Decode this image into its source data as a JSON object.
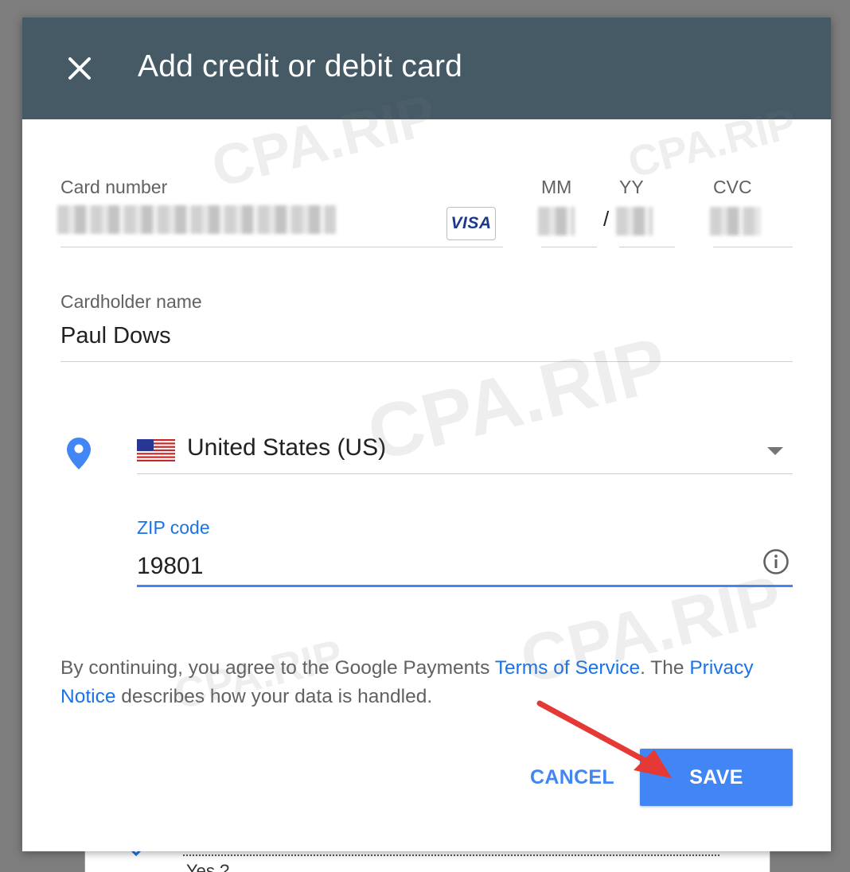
{
  "dialog": {
    "title": "Add credit or debit card",
    "close_icon": "close-icon"
  },
  "card": {
    "number_label": "Card number",
    "number_value": "",
    "brand": "VISA",
    "month_label": "MM",
    "year_label": "YY",
    "separator": "/",
    "cvc_label": "CVC"
  },
  "cardholder": {
    "label": "Cardholder name",
    "value": "Paul Dows"
  },
  "address": {
    "location_icon": "location-pin-icon",
    "country": "United States (US)",
    "flag": "us-flag-icon",
    "zip_label": "ZIP code",
    "zip_value": "19801",
    "info_icon": "info-icon"
  },
  "disclaimer": {
    "prefix": "By continuing, you agree to the Google Payments ",
    "tos_link": "Terms of Service",
    "middle": ". The ",
    "privacy_link": "Privacy Notice",
    "suffix": " describes how your data is handled."
  },
  "actions": {
    "cancel_label": "CANCEL",
    "save_label": "SAVE"
  },
  "background": {
    "partial_text": "Yes ?"
  },
  "watermark": {
    "text": "CPA.RIP"
  },
  "colors": {
    "header": "#455a64",
    "accent": "#4285f4",
    "link": "#1a73e8",
    "arrow": "#e53935"
  }
}
